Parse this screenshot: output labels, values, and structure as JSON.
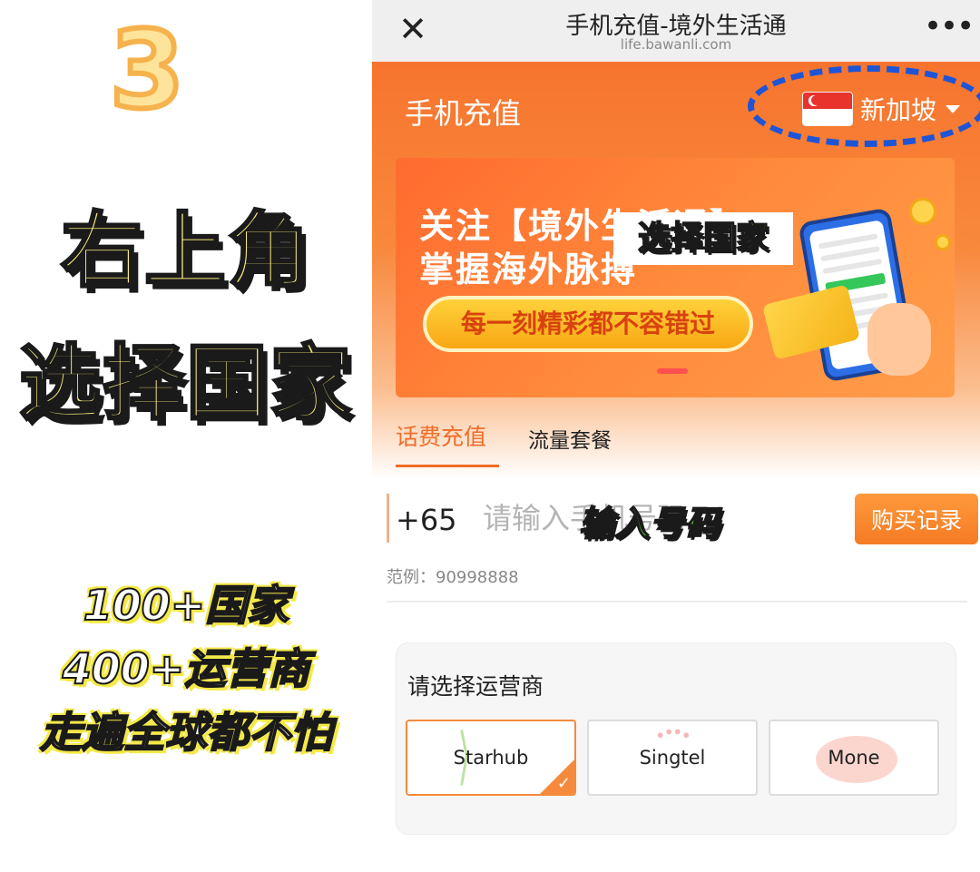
{
  "promo": {
    "step_number": "3",
    "caption_line1": "右上角",
    "caption_line2": "选择国家",
    "stat_line1": "100+国家",
    "stat_line2": "400+运营商",
    "stat_line3": "走遍全球都不怕"
  },
  "browser": {
    "title": "手机充值-境外生活通",
    "url": "life.bawanli.com",
    "close_icon": "close-icon",
    "more_icon": "more-icon"
  },
  "header": {
    "title": "手机充值",
    "country": "新加坡",
    "country_flag": "singapore-flag-icon"
  },
  "banner": {
    "line1": "关注【境外生活通】",
    "line2": "掌握海外脉搏",
    "pill_text": "每一刻精彩都不容错过",
    "overlay_label": "选择国家"
  },
  "tabs": [
    {
      "label": "话费充值",
      "active": true
    },
    {
      "label": "流量套餐",
      "active": false
    }
  ],
  "phone_input": {
    "country_code": "+65",
    "placeholder": "请输入手机号码",
    "overlay_label": "输入号码",
    "buy_record_label": "购买记录",
    "example": "范例：90998888"
  },
  "carriers": {
    "title": "请选择运营商",
    "items": [
      {
        "label": "Starhub",
        "selected": true
      },
      {
        "label": "Singtel",
        "selected": false
      },
      {
        "label": "Mone",
        "selected": false
      }
    ]
  },
  "colors": {
    "accent": "#f06d2a",
    "annotation_blue": "#1e55d6",
    "banner_orange": "#ff7a33"
  }
}
